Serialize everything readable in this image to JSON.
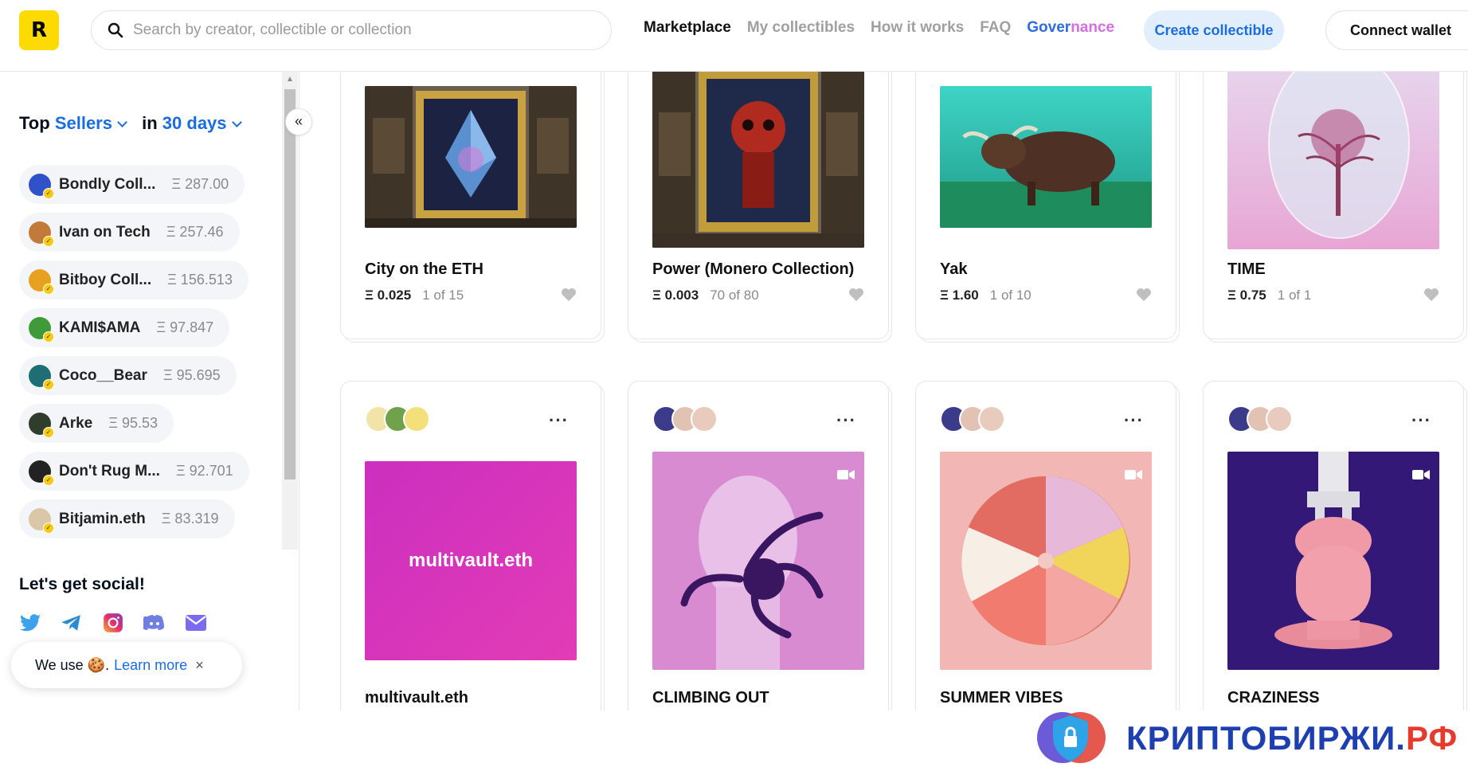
{
  "header": {
    "logo_letter": "R",
    "search_placeholder": "Search by creator, collectible or collection",
    "nav": {
      "marketplace": "Marketplace",
      "my_collectibles": "My collectibles",
      "how_it_works": "How it works",
      "faq": "FAQ",
      "governance_a": "Gover",
      "governance_b": "nance"
    },
    "create_label": "Create collectible",
    "connect_label": "Connect wallet"
  },
  "sidebar": {
    "collapse_glyph": "«",
    "top_label": "Top",
    "category": "Sellers",
    "in_label": "in",
    "period": "30 days",
    "sellers": [
      {
        "name": "Bondly Coll...",
        "value": "Ξ 287.00",
        "color": "#2f52c9"
      },
      {
        "name": "Ivan on Tech",
        "value": "Ξ 257.46",
        "color": "#c27a3a"
      },
      {
        "name": "Bitboy Coll...",
        "value": "Ξ 156.513",
        "color": "#e8a020"
      },
      {
        "name": "KAMI$AMA",
        "value": "Ξ 97.847",
        "color": "#3f9a3a"
      },
      {
        "name": "Coco__Bear",
        "value": "Ξ 95.695",
        "color": "#1e6e73"
      },
      {
        "name": "Arke",
        "value": "Ξ 95.53",
        "color": "#2f3d2a"
      },
      {
        "name": "Don't Rug M...",
        "value": "Ξ 92.701",
        "color": "#222222"
      },
      {
        "name": "Bitjamin.eth",
        "value": "Ξ 83.319",
        "color": "#d9c7a8"
      }
    ],
    "social_title": "Let's get social!",
    "socials": [
      "twitter-icon",
      "telegram-icon",
      "instagram-icon",
      "discord-icon",
      "mail-icon"
    ],
    "cookie": {
      "text": "We use 🍪.",
      "learn": "Learn more",
      "close": "×"
    }
  },
  "cards_row1": [
    {
      "title": "City on the ETH",
      "price": "Ξ 0.025",
      "edition": "1 of 15"
    },
    {
      "title": "Power (Monero Collection)",
      "price": "Ξ 0.003",
      "edition": "70 of 80"
    },
    {
      "title": "Yak",
      "price": "Ξ 1.60",
      "edition": "1 of 10"
    },
    {
      "title": "TIME",
      "price": "Ξ 0.75",
      "edition": "1 of 1"
    }
  ],
  "cards_row2": [
    {
      "title": "multivault.eth",
      "image_text": "multivault.eth"
    },
    {
      "title": "CLIMBING OUT"
    },
    {
      "title": "SUMMER VIBES"
    },
    {
      "title": "CRAZINESS"
    }
  ],
  "more_glyph": "···",
  "watermark": {
    "main": "КРИПТОБИРЖИ.",
    "tld": "РФ"
  }
}
